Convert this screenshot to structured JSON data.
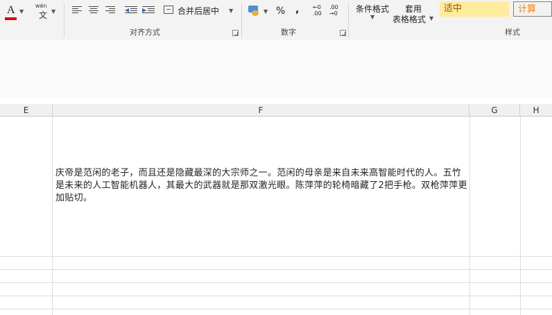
{
  "ribbon": {
    "font_color_glyph": "A",
    "font_color_accent": "#e00000",
    "phonetic_top": "wén",
    "phonetic_bottom": "文",
    "merge_label": "合并后居中",
    "percent": "%",
    "comma": ",",
    "dec_inc": "←0 .00",
    "dec_dec": ".00 →0",
    "cond_format": "条件格式",
    "table_format_1": "套用",
    "table_format_2": "表格格式",
    "style_neutral": "适中",
    "style_neutral_bg": "#ffeb9c",
    "style_neutral_fg": "#9c5700",
    "style_calc": "计算",
    "style_calc_bg": "#f2f2f2",
    "style_calc_fg": "#fa7d00",
    "group_alignment": "对齐方式",
    "group_number": "数字",
    "group_styles": "样式"
  },
  "columns": [
    "E",
    "F",
    "G",
    "H"
  ],
  "cell_F": "庆帝是范闲的老子，而且还是隐藏最深的大宗师之一。范闲的母亲是来自未来高智能时代的人。五竹是未来的人工智能机器人，其最大的武器就是那双激光眼。陈萍萍的轮椅暗藏了2把手枪。双枪萍萍更加贴切。"
}
